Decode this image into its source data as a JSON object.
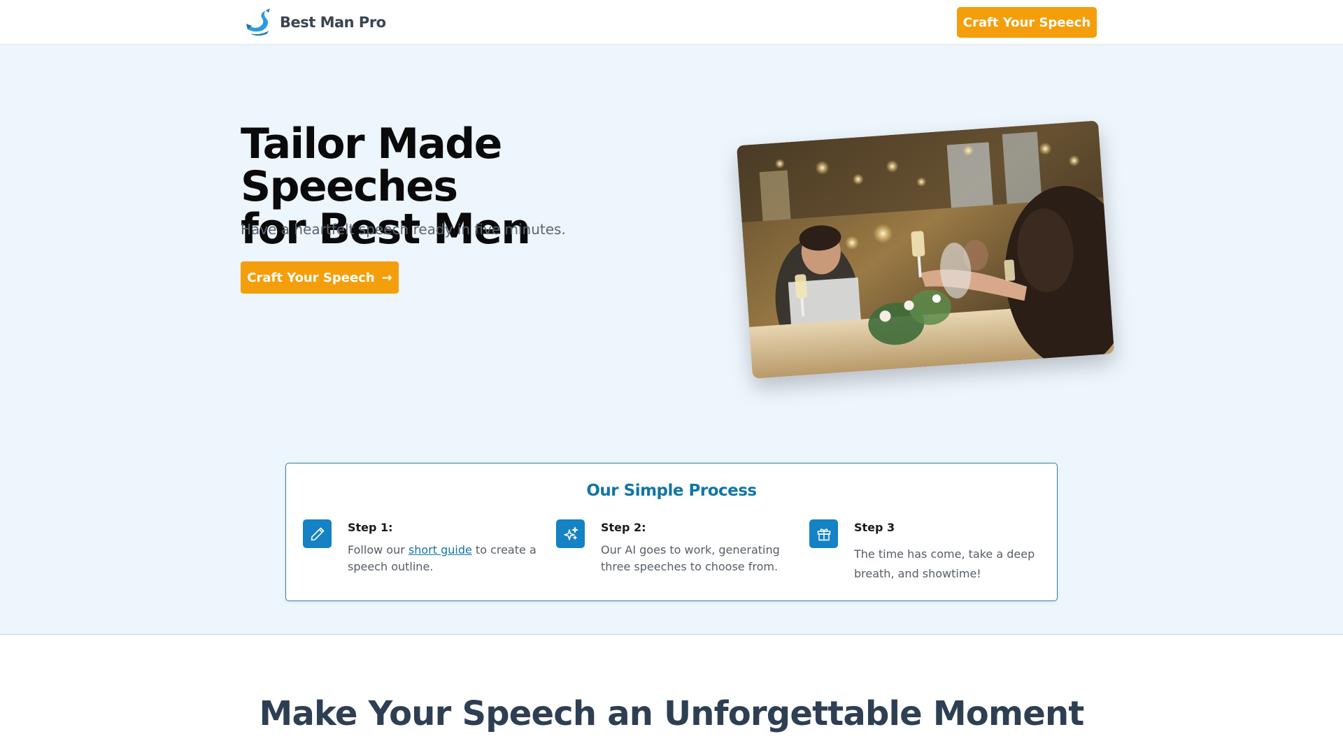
{
  "header": {
    "brand_name": "Best Man Pro",
    "cta_label": "Craft Your Speech"
  },
  "hero": {
    "title_line1": "Tailor Made Speeches",
    "title_line2": "for Best Men",
    "subtitle": "Have a heartfelt speech ready in five minutes.",
    "cta_label": "Craft Your Speech",
    "cta_arrow": "→"
  },
  "process": {
    "title": "Our Simple Process",
    "steps": [
      {
        "title": "Step 1:",
        "text_before": "Follow our ",
        "link_text": "short guide",
        "text_after": " to create a speech outline.",
        "icon": "pencil-icon"
      },
      {
        "title": "Step 2:",
        "text": "Our AI goes to work, generating three speeches to choose from.",
        "icon": "sparkles-icon"
      },
      {
        "title": "Step 3",
        "text": "The time has come, take a deep breath, and showtime!",
        "icon": "gift-icon"
      }
    ]
  },
  "section2": {
    "title": "Make Your Speech an Unforgettable Moment"
  },
  "colors": {
    "accent": "#f59e0b",
    "brand_blue": "#1482c4",
    "hero_bg": "#edf5fd",
    "heading_dark": "#2e3f53"
  }
}
